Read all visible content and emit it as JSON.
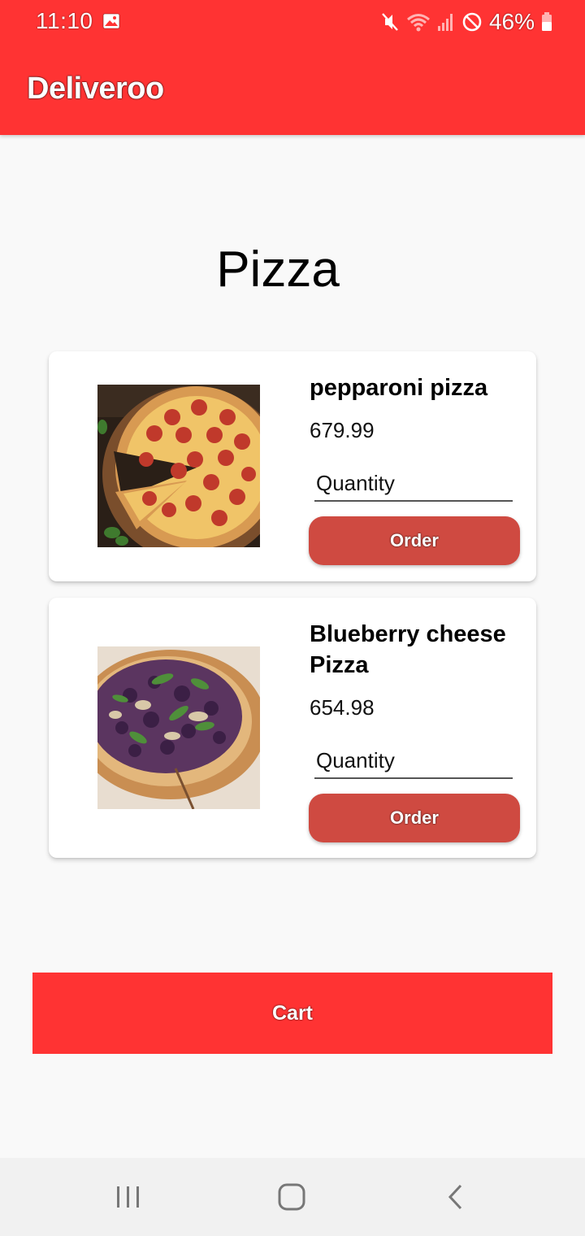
{
  "status_bar": {
    "time": "11:10",
    "battery": "46%",
    "icons": [
      "image-icon",
      "mute-icon",
      "wifi-icon",
      "signal-icon",
      "do-not-disturb-icon",
      "battery-icon"
    ]
  },
  "app_bar": {
    "title": "Deliveroo",
    "color": "#ff3333"
  },
  "page": {
    "title": "Pizza"
  },
  "products": [
    {
      "name": "pepparoni pizza",
      "price": "679.99",
      "quantity_placeholder": "Quantity",
      "order_label": "Order"
    },
    {
      "name": "Blueberry cheese Pizza",
      "price": "654.98",
      "quantity_placeholder": "Quantity",
      "order_label": "Order"
    }
  ],
  "cart": {
    "label": "Cart"
  },
  "colors": {
    "accent": "#ff3333",
    "order_button": "#cf4a41",
    "background": "#f9f9f9"
  },
  "nav_bar": {
    "icons": [
      "recent-apps-icon",
      "home-icon",
      "back-icon"
    ]
  }
}
